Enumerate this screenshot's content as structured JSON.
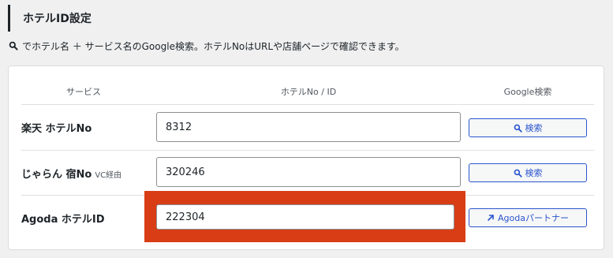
{
  "section": {
    "title": "ホテルID設定"
  },
  "hint": {
    "icon": "search-icon",
    "text": "でホテル名 ＋ サービス名のGoogle検索。ホテルNoはURLや店舗ページで確認できます。"
  },
  "table": {
    "headers": {
      "service": "サービス",
      "id": "ホテルNo / ID",
      "google": "Google検索"
    },
    "rows": [
      {
        "label": "楽天 ホテルNo",
        "sub": "",
        "value": "8312",
        "button_label": "検索",
        "button_icon": "search-icon"
      },
      {
        "label": "じゃらん 宿No",
        "sub": "VC経由",
        "value": "320246",
        "button_label": "検索",
        "button_icon": "search-icon"
      },
      {
        "label": "Agoda ホテルID",
        "sub": "",
        "value": "222304",
        "button_label": "Agodaパートナー",
        "button_icon": "external-arrow-icon"
      }
    ]
  },
  "colors": {
    "accent": "#2b55cf",
    "highlight": "#d93d15",
    "background": "#f0f0f1"
  }
}
